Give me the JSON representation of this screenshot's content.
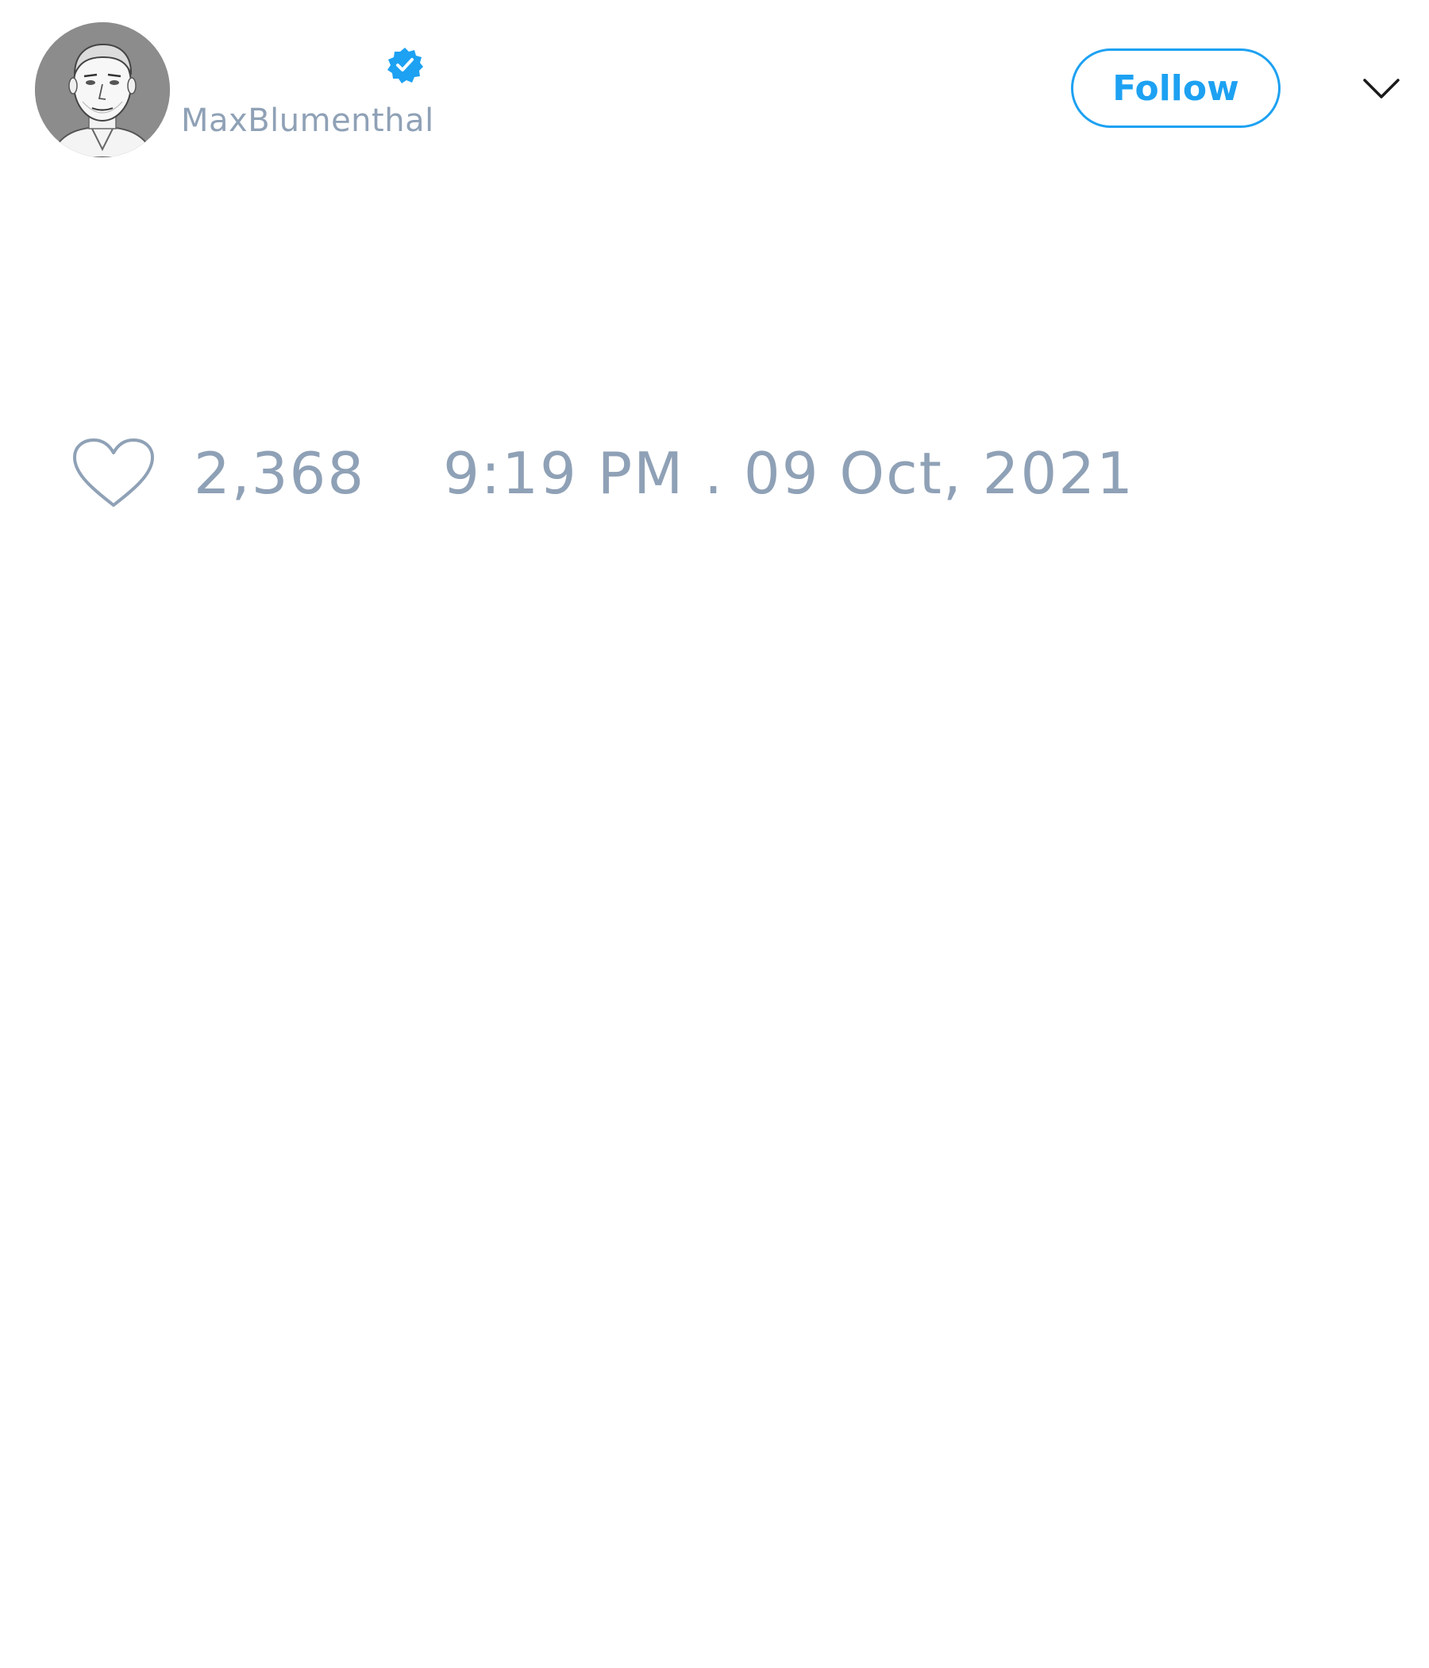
{
  "tweet": {
    "author": {
      "handle": "MaxBlumenthal",
      "verified": true,
      "avatar_icon": "user-portrait-sketch"
    },
    "follow_label": "Follow",
    "more_icon": "chevron-down-icon",
    "like_icon": "heart-outline-icon",
    "like_count": "2,368",
    "timestamp": "9:19 PM . 09 Oct, 2021"
  },
  "colors": {
    "accent": "#1da1f2",
    "muted_text": "#8fa1b6",
    "background": "#ffffff"
  }
}
